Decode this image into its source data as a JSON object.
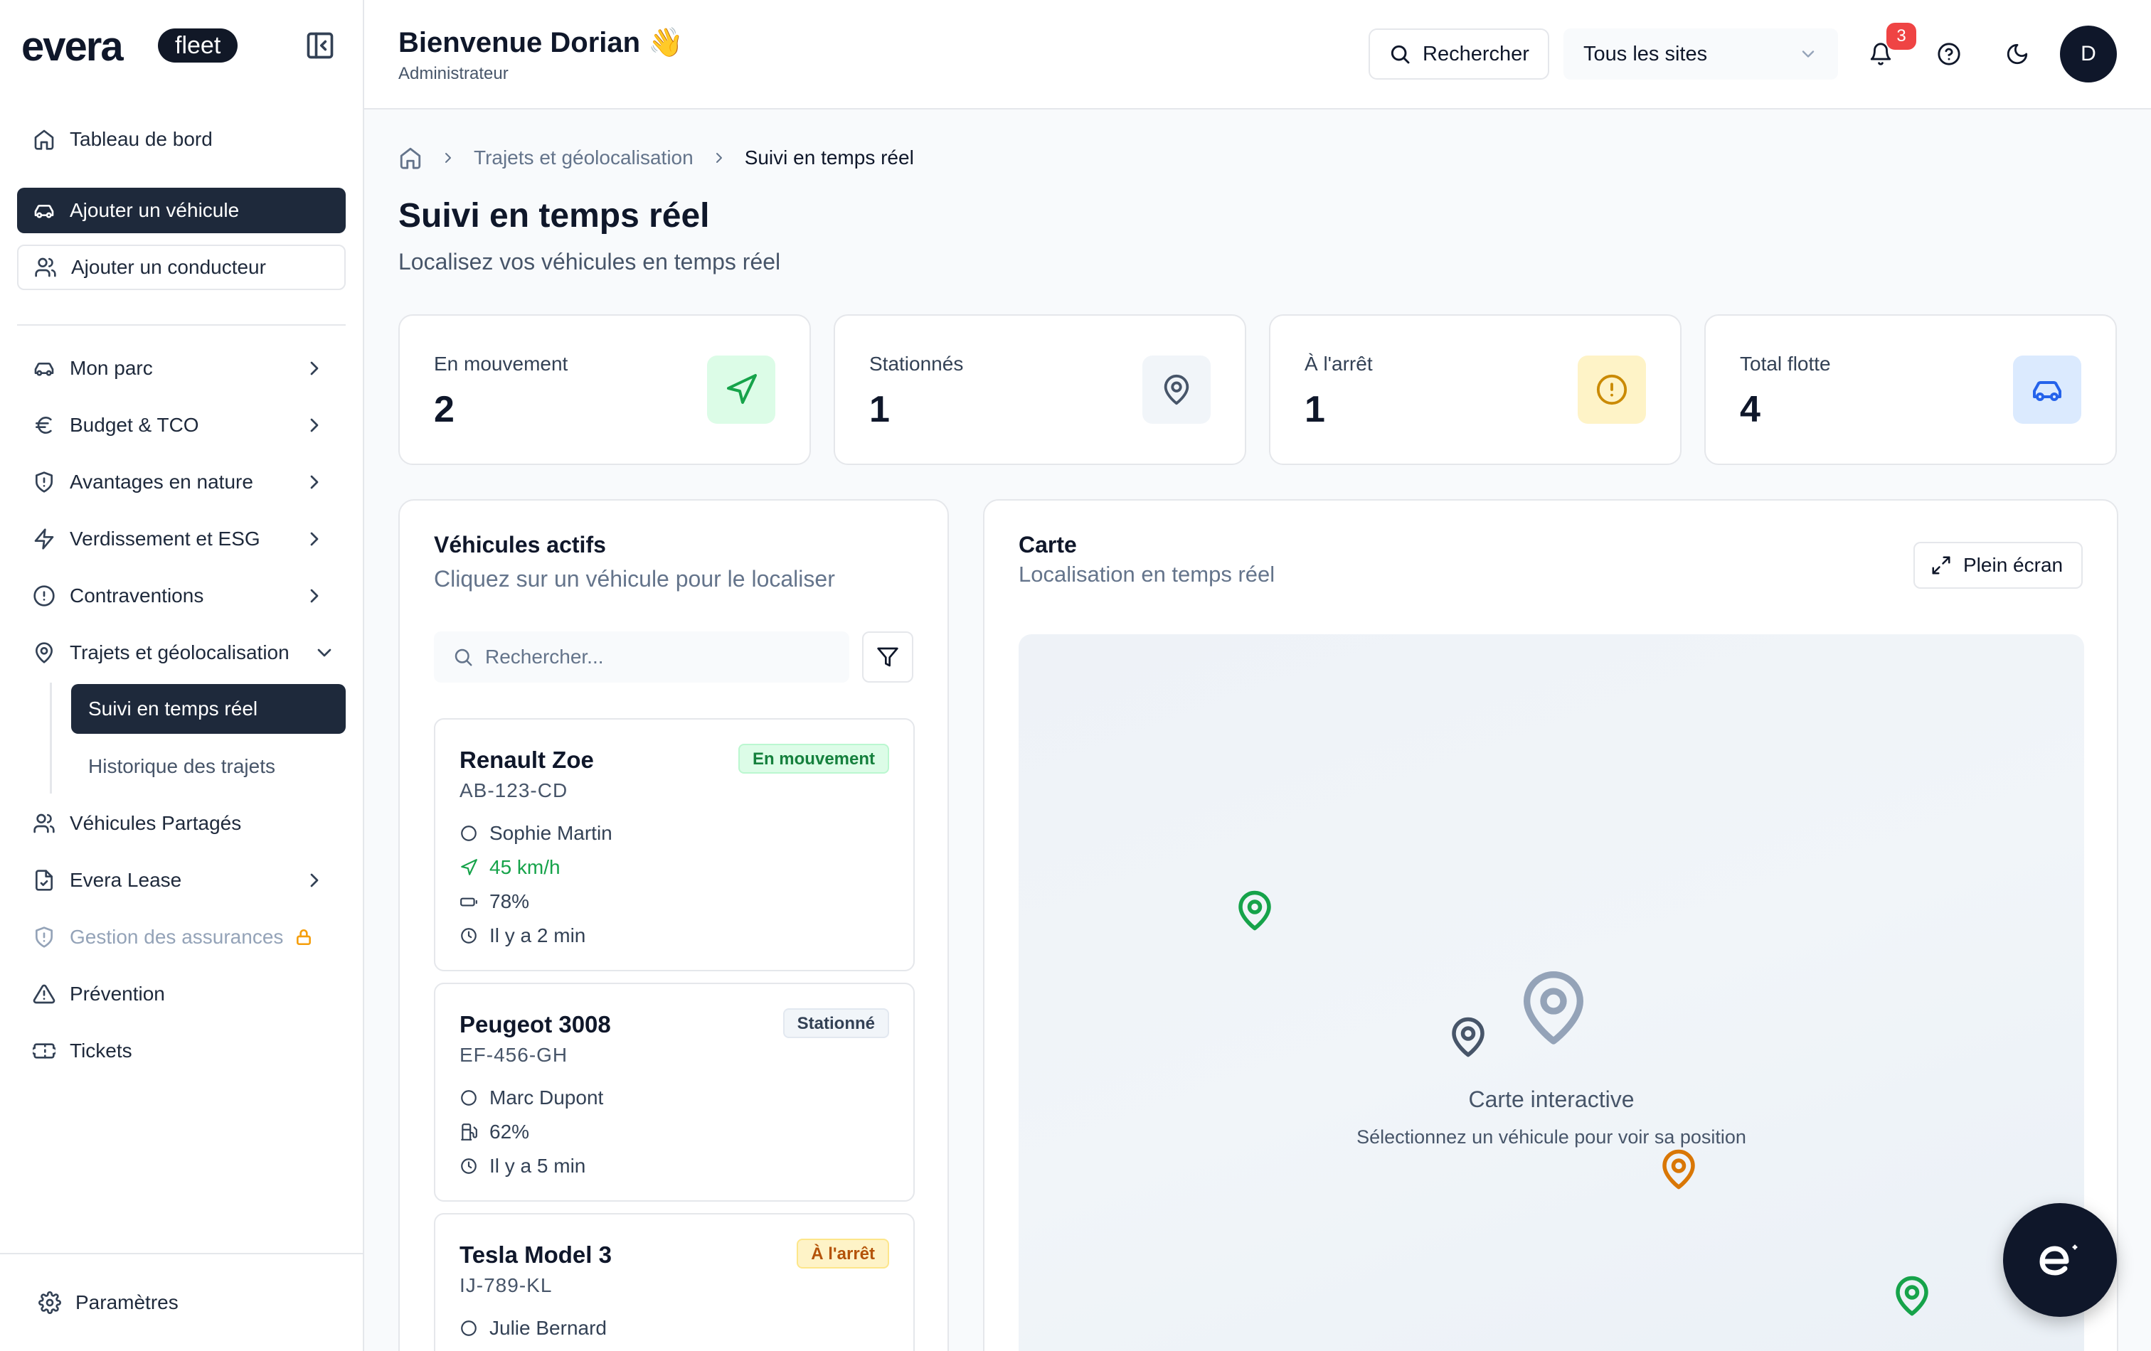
{
  "brand": {
    "logo_text": "evera",
    "badge": "fleet"
  },
  "sidebar": {
    "dashboard": "Tableau de bord",
    "add_vehicle": "Ajouter un véhicule",
    "add_driver": "Ajouter un conducteur",
    "items": [
      {
        "label": "Mon parc",
        "icon": "car-icon"
      },
      {
        "label": "Budget & TCO",
        "icon": "euro-icon"
      },
      {
        "label": "Avantages en nature",
        "icon": "shield-icon"
      },
      {
        "label": "Verdissement et ESG",
        "icon": "zap-icon"
      },
      {
        "label": "Contraventions",
        "icon": "alert-circle-icon"
      },
      {
        "label": "Trajets et géolocalisation",
        "icon": "map-pin-icon"
      }
    ],
    "sub_items": [
      {
        "label": "Suivi en temps réel"
      },
      {
        "label": "Historique des trajets"
      }
    ],
    "shared_vehicles": "Véhicules Partagés",
    "lease": "Evera Lease",
    "insurance": "Gestion des assurances",
    "prevention": "Prévention",
    "tickets": "Tickets",
    "settings": "Paramètres"
  },
  "header": {
    "welcome": "Bienvenue Dorian 👋",
    "role": "Administrateur",
    "search_label": "Rechercher",
    "site_select": "Tous les sites",
    "notification_count": "3",
    "avatar_initial": "D"
  },
  "breadcrumb": {
    "section": "Trajets et géolocalisation",
    "current": "Suivi en temps réel"
  },
  "page": {
    "title": "Suivi en temps réel",
    "subtitle": "Localisez vos véhicules en temps réel"
  },
  "stats": [
    {
      "label": "En mouvement",
      "value": "2",
      "color": "#16a34a",
      "bg": "#dcfce7",
      "icon": "navigation-icon"
    },
    {
      "label": "Stationnés",
      "value": "1",
      "color": "#475569",
      "bg": "#f1f5f9",
      "icon": "map-pin-icon"
    },
    {
      "label": "À l'arrêt",
      "value": "1",
      "color": "#ca8a04",
      "bg": "#fef3c7",
      "icon": "alert-circle-icon"
    },
    {
      "label": "Total flotte",
      "value": "4",
      "color": "#2563eb",
      "bg": "#dbeafe",
      "icon": "car-icon"
    }
  ],
  "vehicles_panel": {
    "title": "Véhicules actifs",
    "subtitle": "Cliquez sur un véhicule pour le localiser",
    "search_placeholder": "Rechercher...",
    "vehicles": [
      {
        "name": "Renault Zoe",
        "plate": "AB-123-CD",
        "status": "En mouvement",
        "driver": "Sophie Martin",
        "speed": "45 km/h",
        "battery": "78%",
        "last_update": "Il y a 2 min"
      },
      {
        "name": "Peugeot 3008",
        "plate": "EF-456-GH",
        "status": "Stationné",
        "driver": "Marc Dupont",
        "fuel": "62%",
        "last_update": "Il y a 5 min"
      },
      {
        "name": "Tesla Model 3",
        "plate": "IJ-789-KL",
        "status": "À l'arrêt",
        "driver": "Julie Bernard"
      }
    ]
  },
  "map_panel": {
    "title": "Carte",
    "subtitle": "Localisation en temps réel",
    "fullscreen": "Plein écran",
    "placeholder_title": "Carte interactive",
    "placeholder_sub": "Sélectionnez un véhicule pour voir sa position",
    "pin_colors": {
      "moving": "#16a34a",
      "parked": "#475569",
      "stopped": "#d97706",
      "center": "#94a3b8"
    }
  }
}
